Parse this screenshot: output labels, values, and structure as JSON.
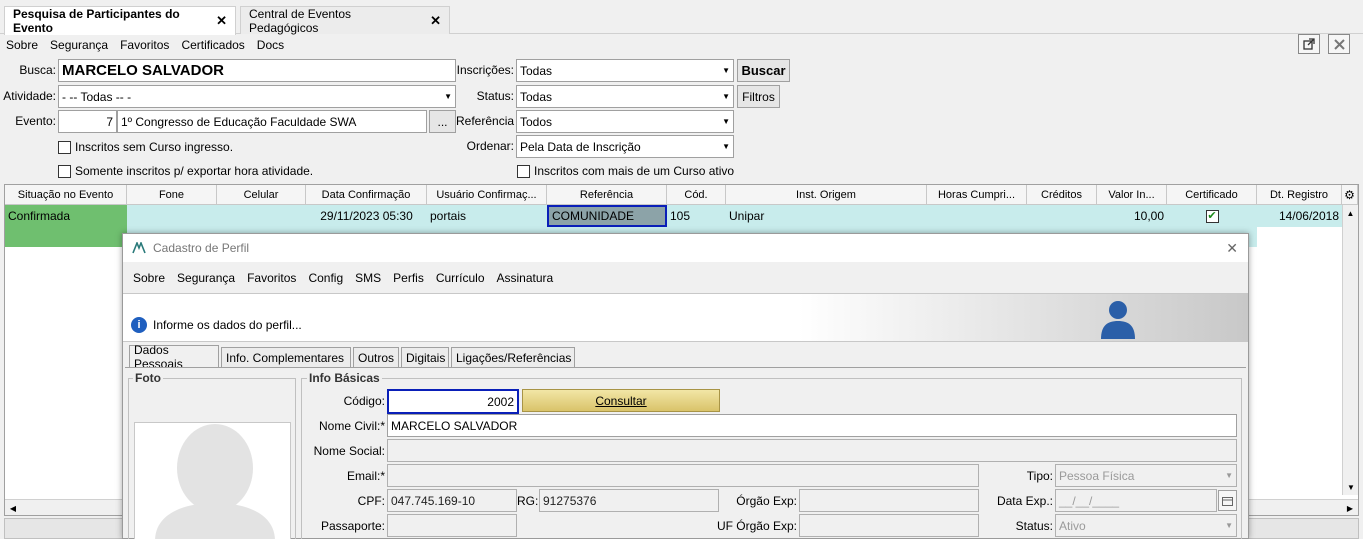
{
  "tabs": [
    {
      "label": "Pesquisa de Participantes do Evento",
      "close": "✕"
    },
    {
      "label": "Central de Eventos Pedagógicos",
      "close": "✕"
    }
  ],
  "menu": [
    "Sobre",
    "Segurança",
    "Favoritos",
    "Certificados",
    "Docs"
  ],
  "search": {
    "busca_label": "Busca:",
    "busca_value": "MARCELO SALVADOR",
    "atividade_label": "Atividade:",
    "atividade_value": "- -- Todas -- -",
    "evento_label": "Evento:",
    "evento_id": "7",
    "evento_name": "1º Congresso de Educação Faculdade SWA",
    "evento_btn": "...",
    "inscricoes_label": "Inscrições:",
    "inscricoes_value": "Todas",
    "status_label": "Status:",
    "status_value": "Todas",
    "referencia_label": "Referência",
    "referencia_value": "Todos",
    "ordenar_label": "Ordenar:",
    "ordenar_value": "Pela Data de Inscrição",
    "buscar_btn": "Buscar",
    "filtros_btn": "Filtros",
    "chk1": "Inscritos sem Curso ingresso.",
    "chk2": "Somente inscritos p/ exportar hora atividade.",
    "chk3": "Inscritos com mais de um Curso ativo"
  },
  "grid": {
    "headers": [
      "Situação no Evento",
      "Fone",
      "Celular",
      "Data Confirmação",
      "Usuário Confirmaç...",
      "Referência",
      "Cód.",
      "Inst. Origem",
      "Horas Cumpri...",
      "Créditos",
      "Valor In...",
      "Certificado",
      "Dt. Registro"
    ],
    "row": {
      "situacao": "Confirmada",
      "fone": "",
      "celular": "",
      "data_confirmacao": "29/11/2023 05:30",
      "usuario": "portais",
      "referencia": "COMUNIDADE",
      "cod": "105",
      "inst_origem": "Unipar",
      "horas": "",
      "creditos": "",
      "valor": "10,00",
      "certificado": "✔",
      "dt_registro": "14/06/2018"
    }
  },
  "dialog": {
    "title": "Cadastro de Perfil",
    "close": "✕",
    "menu": [
      "Sobre",
      "Segurança",
      "Favoritos",
      "Config",
      "SMS",
      "Perfis",
      "Currículo",
      "Assinatura"
    ],
    "info": "Informe os dados do perfil...",
    "tabs": [
      "Dados Pessoais",
      "Info. Complementares",
      "Outros",
      "Digitais",
      "Ligações/Referências"
    ],
    "foto_title": "Foto",
    "info_title": "Info Básicas",
    "codigo_label": "Código:",
    "codigo_value": "2002",
    "consultar_btn": "Consultar",
    "nome_civil_label": "Nome Civil:*",
    "nome_civil_value": "MARCELO SALVADOR",
    "nome_social_label": "Nome Social:",
    "nome_social_value": "",
    "email_label": "Email:*",
    "email_value": "",
    "tipo_label": "Tipo:",
    "tipo_value": "Pessoa Física",
    "cpf_label": "CPF:",
    "cpf_value": "047.745.169-10",
    "rg_label": "RG:",
    "rg_value": "91275376",
    "orgao_label": "Órgão Exp:",
    "orgao_value": "",
    "data_exp_label": "Data Exp.:",
    "data_exp_value": "__/__/____",
    "passaporte_label": "Passaporte:",
    "passaporte_value": "",
    "uf_label": "UF Órgão Exp:",
    "uf_value": "",
    "status_label": "Status:",
    "status_value": "Ativo"
  }
}
